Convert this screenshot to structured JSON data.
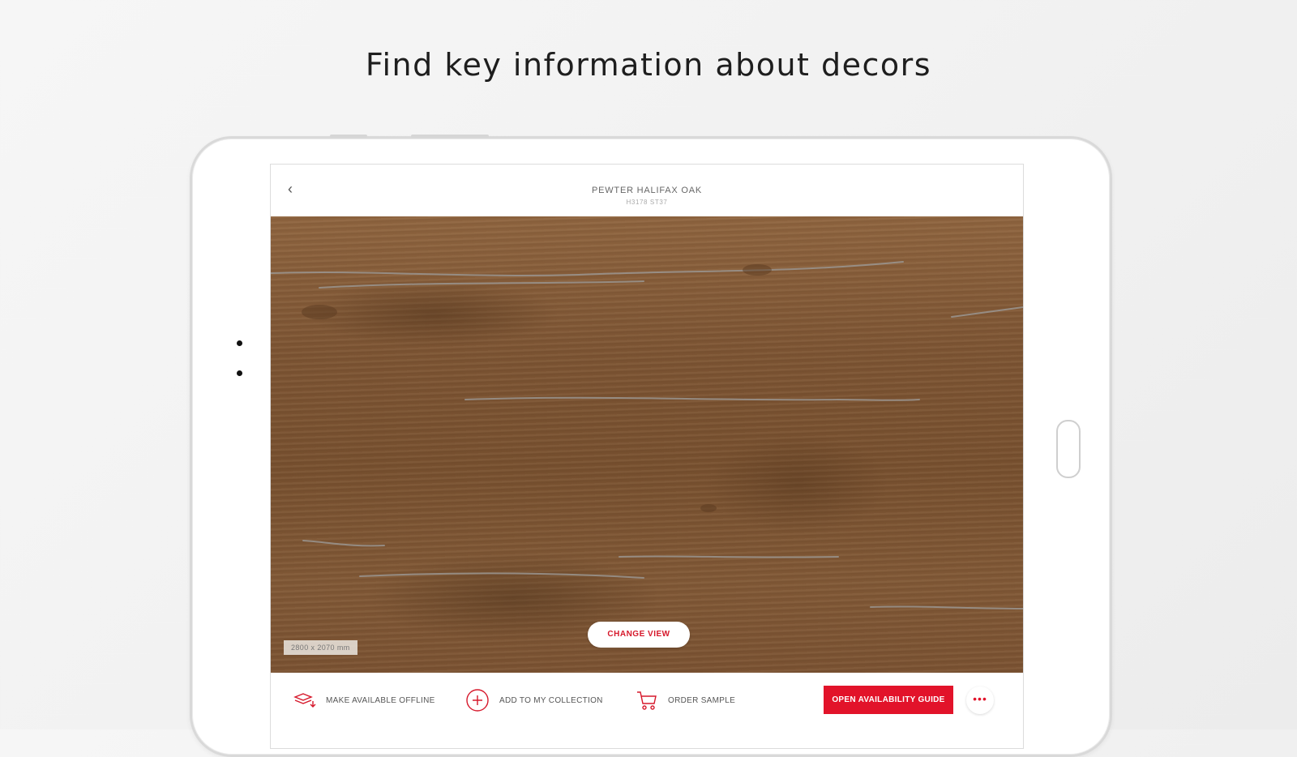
{
  "headline": "Find key information about decors",
  "screen": {
    "title": "PEWTER HALIFAX OAK",
    "code": "H3178 ST37",
    "back_icon": "chevron-left-icon",
    "size_label": "2800 x 2070 mm",
    "change_view_label": "CHANGE VIEW",
    "actions": [
      {
        "icon": "layers-download-icon",
        "label": "MAKE AVAILABLE OFFLINE"
      },
      {
        "icon": "plus-circle-icon",
        "label": "ADD TO MY COLLECTION"
      },
      {
        "icon": "cart-icon",
        "label": "ORDER SAMPLE"
      }
    ],
    "availability_label": "OPEN AVAILABILITY GUIDE",
    "more_label": "•••",
    "accent_color": "#e2132a"
  }
}
